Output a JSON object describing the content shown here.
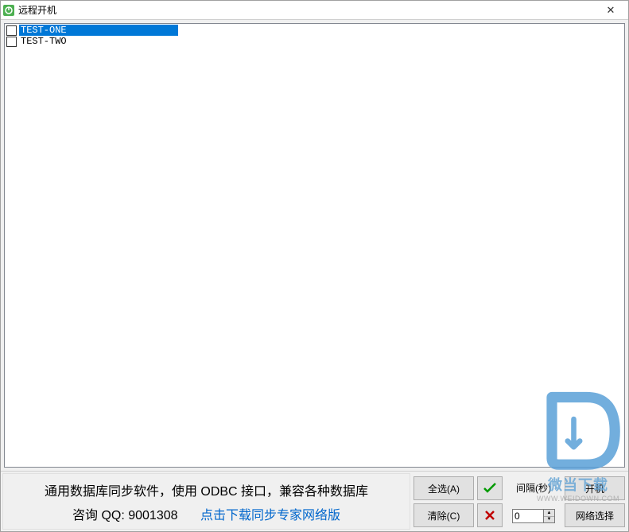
{
  "window": {
    "title": "远程开机"
  },
  "list": {
    "items": [
      {
        "label": "TEST-ONE",
        "checked": false,
        "selected": true
      },
      {
        "label": "TEST-TWO",
        "checked": false,
        "selected": false
      }
    ]
  },
  "promo": {
    "line1": "通用数据库同步软件，使用 ODBC 接口，兼容各种数据库",
    "qq_text": "咨询 QQ: 9001308",
    "link_text": "点击下载同步专家网络版"
  },
  "buttons": {
    "select_all": "全选(A)",
    "clear": "清除(C)",
    "power_on": "开机",
    "network_select": "网络选择"
  },
  "interval": {
    "label": "间隔(秒)",
    "value": "0"
  },
  "watermark": {
    "name": "微当下载",
    "sub": "WWW.WEIDOWN.COM"
  }
}
